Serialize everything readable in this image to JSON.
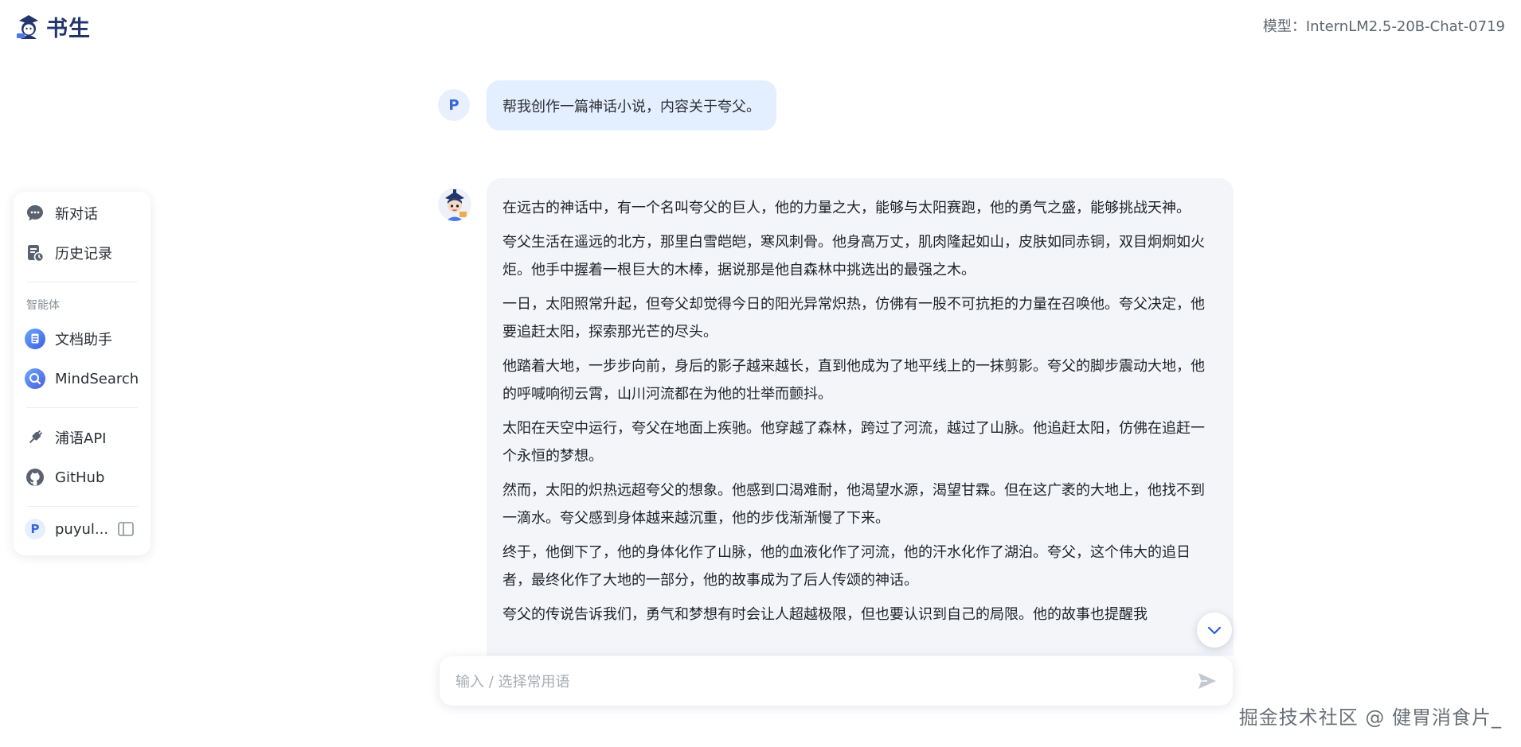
{
  "header": {
    "logo_text": "书生",
    "model_label": "模型：InternLM2.5-20B-Chat-0719"
  },
  "sidebar": {
    "new_chat": "新对话",
    "history": "历史记录",
    "section_agents": "智能体",
    "doc_assistant": "文档助手",
    "mindsearch": "MindSearch",
    "api": "浦语API",
    "github": "GitHub",
    "user_initial": "P",
    "user_name": "puyul..."
  },
  "chat": {
    "user_avatar": "P",
    "user_message": "帮我创作一篇神话小说，内容关于夸父。",
    "assistant_paragraphs": [
      "在远古的神话中，有一个名叫夸父的巨人，他的力量之大，能够与太阳赛跑，他的勇气之盛，能够挑战天神。",
      "夸父生活在遥远的北方，那里白雪皑皑，寒风刺骨。他身高万丈，肌肉隆起如山，皮肤如同赤铜，双目炯炯如火炬。他手中握着一根巨大的木棒，据说那是他自森林中挑选出的最强之木。",
      "一日，太阳照常升起，但夸父却觉得今日的阳光异常炽热，仿佛有一股不可抗拒的力量在召唤他。夸父决定，他要追赶太阳，探索那光芒的尽头。",
      "他踏着大地，一步步向前，身后的影子越来越长，直到他成为了地平线上的一抹剪影。夸父的脚步震动大地，他的呼喊响彻云霄，山川河流都在为他的壮举而颤抖。",
      "太阳在天空中运行，夸父在地面上疾驰。他穿越了森林，跨过了河流，越过了山脉。他追赶太阳，仿佛在追赶一个永恒的梦想。",
      "然而，太阳的炽热远超夸父的想象。他感到口渴难耐，他渴望水源，渴望甘霖。但在这广袤的大地上，他找不到一滴水。夸父感到身体越来越沉重，他的步伐渐渐慢了下来。",
      "终于，他倒下了，他的身体化作了山脉，他的血液化作了河流，他的汗水化作了湖泊。夸父，这个伟大的追日者，最终化作了大地的一部分，他的故事成为了后人传颂的神话。",
      "夸父的传说告诉我们，勇气和梦想有时会让人超越极限，但也要认识到自己的局限。他的故事也提醒我"
    ]
  },
  "composer": {
    "placeholder": "输入 / 选择常用语"
  },
  "watermark": "掘金技术社区 @ 健胃消食片_",
  "colors": {
    "brand": "#23366b",
    "user_bubble": "#e3effe",
    "assistant_bubble": "#f3f5f9",
    "accent_blue": "#3a66d8"
  },
  "icons": {
    "new_chat": "chat-bubble-icon",
    "history": "history-icon",
    "doc_assistant": "document-icon",
    "mindsearch": "search-icon",
    "api": "plug-icon",
    "github": "github-icon",
    "collapse": "sidebar-collapse-icon",
    "scroll_down": "chevron-down-icon",
    "send": "send-icon"
  }
}
